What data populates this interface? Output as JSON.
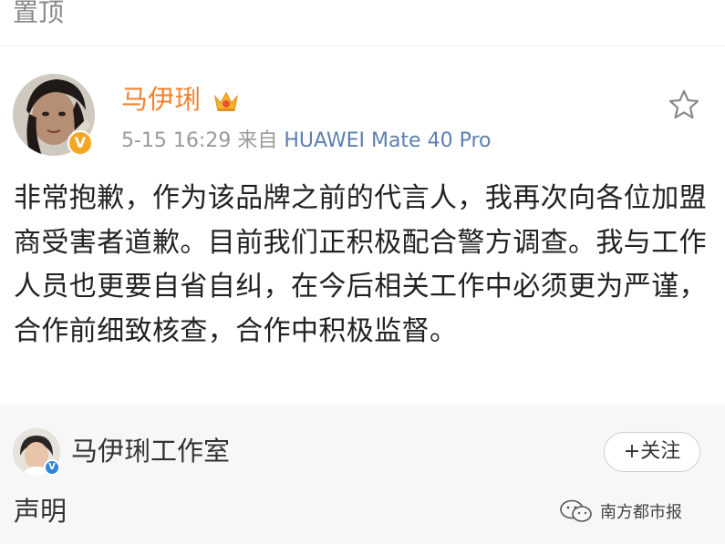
{
  "top": {
    "pinned_label": "置顶"
  },
  "post": {
    "author": "马伊琍",
    "date": "5-15 16:29",
    "from_label": "来自",
    "source": "HUAWEI Mate 40 Pro",
    "text": "非常抱歉，作为该品牌之前的代言人，我再次向各位加盟商受害者道歉。目前我们正积极配合警方调查。我与工作人员也更要自省自纠，在今后相关工作中必须更为严谨，合作前细致核查，合作中积极监督。",
    "badge_icon": "verified-orange-v-icon",
    "crown_icon": "crown-icon",
    "star_icon": "star-outline-icon"
  },
  "repost": {
    "author": "马伊琍工作室",
    "follow_label": "+关注",
    "statement": "声明",
    "badge_icon": "verified-blue-v-icon"
  },
  "watermark": {
    "text": "南方都市报",
    "icon": "wechat-icon"
  },
  "colors": {
    "author_orange": "#f08330",
    "source_blue": "#5b7fb0",
    "meta_grey": "#9a9a9a",
    "repost_bg": "#f7f7f7",
    "verified_blue": "#2e86de",
    "verified_orange": "#f5a623"
  }
}
